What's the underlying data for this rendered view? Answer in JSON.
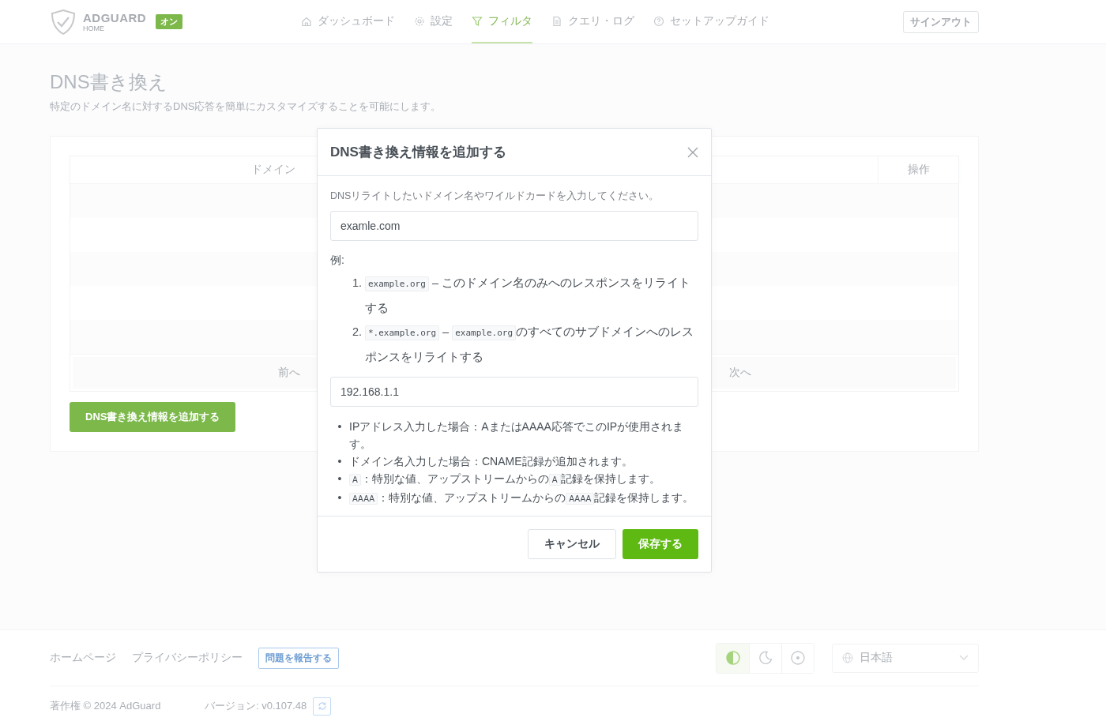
{
  "header": {
    "logo": {
      "name": "ADGUARD",
      "sub": "HOME"
    },
    "status_badge": "オン",
    "nav": [
      {
        "kind": "home",
        "label": "ダッシュボード",
        "selected": false
      },
      {
        "kind": "gear",
        "label": "設定",
        "selected": false
      },
      {
        "kind": "filter",
        "label": "フィルタ",
        "selected": true
      },
      {
        "kind": "doc",
        "label": "クエリ・ログ",
        "selected": false
      },
      {
        "kind": "help",
        "label": "セットアップガイド",
        "selected": false
      }
    ],
    "sign_out": "サインアウト"
  },
  "page": {
    "title": "DNS書き換え",
    "subtitle": "特定のドメイン名に対するDNS応答を簡単にカスタマイズすることを可能にします。",
    "table": {
      "columns": [
        "ドメイン",
        "操作"
      ],
      "pagination": {
        "previous": "前へ",
        "next": "次へ"
      }
    },
    "add_button": "DNS書き換え情報を追加する"
  },
  "modal": {
    "title": "DNS書き換え情報を追加する",
    "description": "DNSリライトしたいドメイン名やワイルドカードを入力してください。",
    "domain_input": {
      "value": "examle.com"
    },
    "examples_label": "例:",
    "examples": [
      {
        "number": "1.",
        "parts": [
          {
            "kind": "code",
            "text": "example.org"
          },
          {
            "kind": "text",
            "text": " – このドメイン名のみへのレスポンスをリライトする"
          }
        ]
      },
      {
        "number": "2.",
        "parts": [
          {
            "kind": "code",
            "text": "*.example.org"
          },
          {
            "kind": "text",
            "text": " – "
          },
          {
            "kind": "code",
            "text": "example.org"
          },
          {
            "kind": "text",
            "text": "のすべてのサブドメインへのレスポンスをリライトする"
          }
        ]
      }
    ],
    "answer_input": {
      "value": "192.168.1.1"
    },
    "notes": [
      {
        "bullet": "•",
        "parts": [
          {
            "kind": "text",
            "text": "IPアドレス入力した場合：AまたはAAAA応答でこのIPが使用されます。"
          }
        ]
      },
      {
        "bullet": "•",
        "parts": [
          {
            "kind": "text",
            "text": "ドメイン名入力した場合：CNAME記録が追加されます。"
          }
        ]
      },
      {
        "bullet": "•",
        "parts": [
          {
            "kind": "code",
            "text": "A"
          },
          {
            "kind": "text",
            "text": "：特別な値、アップストリームからの"
          },
          {
            "kind": "code",
            "text": "A"
          },
          {
            "kind": "text",
            "text": "記録を保持します。"
          }
        ]
      },
      {
        "bullet": "•",
        "parts": [
          {
            "kind": "code",
            "text": "AAAA"
          },
          {
            "kind": "text",
            "text": "：特別な値、アップストリームからの"
          },
          {
            "kind": "code",
            "text": "AAAA"
          },
          {
            "kind": "text",
            "text": "記録を保持します。"
          }
        ]
      }
    ],
    "cancel_button": "キャンセル",
    "save_button": "保存する"
  },
  "footer": {
    "links": [
      "ホームページ",
      "プライバシーポリシー"
    ],
    "report_button": "問題を報告する",
    "themes": [
      {
        "kind": "auto",
        "selected": true
      },
      {
        "kind": "dark",
        "selected": false
      },
      {
        "kind": "light",
        "selected": false
      }
    ],
    "language": "日本語",
    "copyright": "著作権 © 2024 AdGuard",
    "version": "バージョン: v0.107.48"
  }
}
